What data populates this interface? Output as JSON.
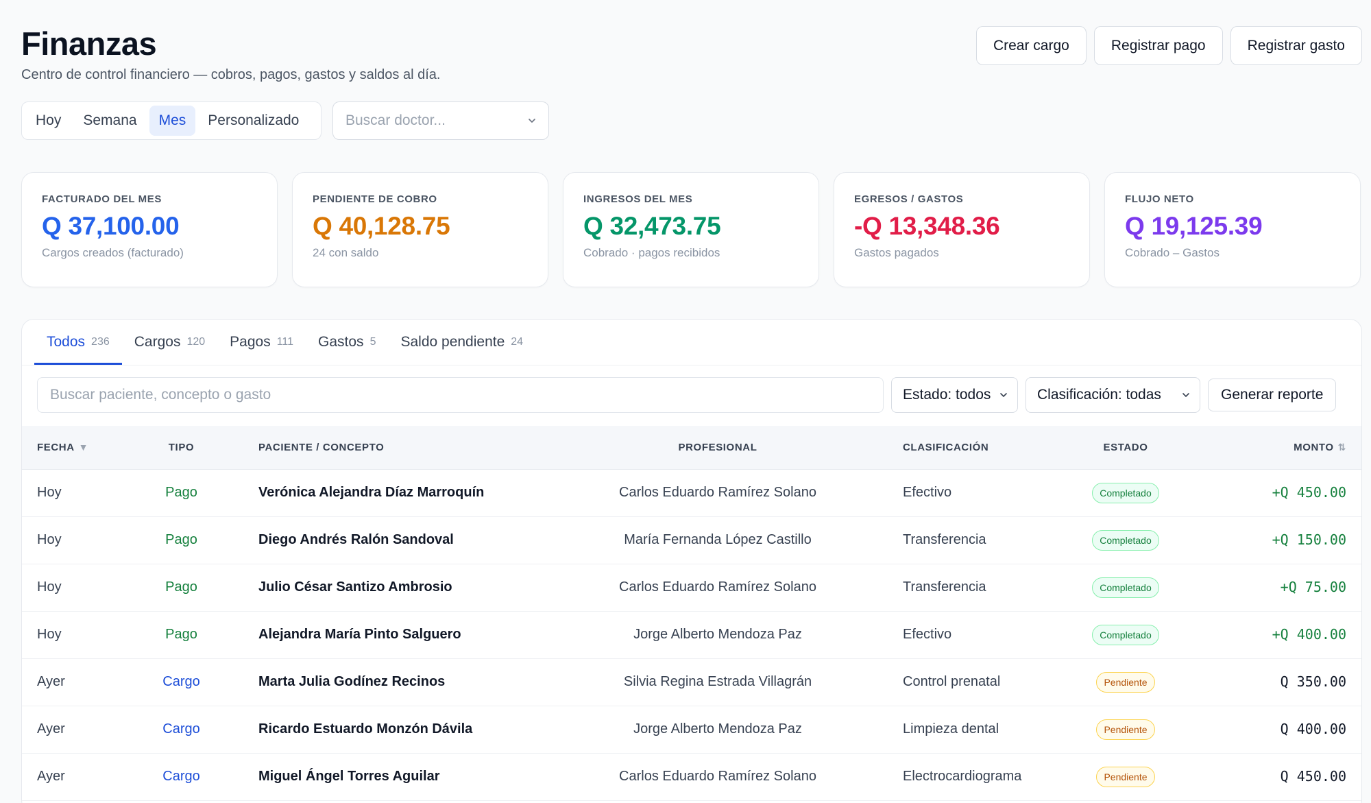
{
  "header": {
    "title": "Finanzas",
    "subtitle": "Centro de control financiero — cobros, pagos, gastos y saldos al día.",
    "actions": [
      "Crear cargo",
      "Registrar pago",
      "Registrar gasto"
    ]
  },
  "period": {
    "options": [
      "Hoy",
      "Semana",
      "Mes",
      "Personalizado"
    ],
    "selected": "Mes"
  },
  "doctor_select": {
    "placeholder": "Buscar doctor..."
  },
  "kpis": [
    {
      "label": "Facturado del mes",
      "value": "Q 37,100.00",
      "sub": "Cargos creados (facturado)",
      "color": "#2563eb"
    },
    {
      "label": "Pendiente de cobro",
      "value": "Q 40,128.75",
      "sub": "24 con saldo",
      "color": "#d97706"
    },
    {
      "label": "Ingresos del mes",
      "value": "Q 32,473.75",
      "sub": "Cobrado · pagos recibidos",
      "color": "#059669"
    },
    {
      "label": "Egresos / Gastos",
      "value": "-Q 13,348.36",
      "sub": "Gastos pagados",
      "color": "#e11d48"
    },
    {
      "label": "Flujo neto",
      "value": "Q 19,125.39",
      "sub": "Cobrado – Gastos",
      "color": "#7c3aed"
    }
  ],
  "tabs": [
    {
      "label": "Todos",
      "count": "236",
      "active": true
    },
    {
      "label": "Cargos",
      "count": "120"
    },
    {
      "label": "Pagos",
      "count": "111"
    },
    {
      "label": "Gastos",
      "count": "5"
    },
    {
      "label": "Saldo pendiente",
      "count": "24"
    }
  ],
  "filters": {
    "search_placeholder": "Buscar paciente, concepto o gasto",
    "estado": "Estado: todos",
    "clasificacion": "Clasificación: todas",
    "report_button": "Generar reporte"
  },
  "table": {
    "columns": [
      "Fecha",
      "Tipo",
      "Paciente / Concepto",
      "Profesional",
      "Clasificación",
      "Estado",
      "Monto"
    ],
    "rows": [
      {
        "fecha": "Hoy",
        "tipo": "Pago",
        "paciente": "Verónica Alejandra Díaz Marroquín",
        "profesional": "Carlos Eduardo Ramírez Solano",
        "clasificacion": "Efectivo",
        "estado": "Completado",
        "monto": "+Q 450.00"
      },
      {
        "fecha": "Hoy",
        "tipo": "Pago",
        "paciente": "Diego Andrés Ralón Sandoval",
        "profesional": "María Fernanda López Castillo",
        "clasificacion": "Transferencia",
        "estado": "Completado",
        "monto": "+Q 150.00"
      },
      {
        "fecha": "Hoy",
        "tipo": "Pago",
        "paciente": "Julio César Santizo Ambrosio",
        "profesional": "Carlos Eduardo Ramírez Solano",
        "clasificacion": "Transferencia",
        "estado": "Completado",
        "monto": "+Q 75.00"
      },
      {
        "fecha": "Hoy",
        "tipo": "Pago",
        "paciente": "Alejandra María Pinto Salguero",
        "profesional": "Jorge Alberto Mendoza Paz",
        "clasificacion": "Efectivo",
        "estado": "Completado",
        "monto": "+Q 400.00"
      },
      {
        "fecha": "Ayer",
        "tipo": "Cargo",
        "paciente": "Marta Julia Godínez Recinos",
        "profesional": "Silvia Regina Estrada Villagrán",
        "clasificacion": "Control prenatal",
        "estado": "Pendiente",
        "monto": "Q 350.00"
      },
      {
        "fecha": "Ayer",
        "tipo": "Cargo",
        "paciente": "Ricardo Estuardo Monzón Dávila",
        "profesional": "Jorge Alberto Mendoza Paz",
        "clasificacion": "Limpieza dental",
        "estado": "Pendiente",
        "monto": "Q 400.00"
      },
      {
        "fecha": "Ayer",
        "tipo": "Cargo",
        "paciente": "Miguel Ángel Torres Aguilar",
        "profesional": "Carlos Eduardo Ramírez Solano",
        "clasificacion": "Electrocardiograma",
        "estado": "Pendiente",
        "monto": "Q 450.00"
      }
    ]
  }
}
